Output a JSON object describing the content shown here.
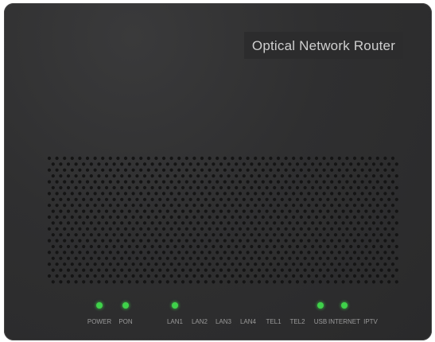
{
  "device": {
    "title": "Optical Network Router"
  },
  "indicators": [
    {
      "label": "POWER",
      "lit": true
    },
    {
      "label": "PON",
      "lit": true
    },
    {
      "label": "LAN1",
      "lit": true
    },
    {
      "label": "LAN2",
      "lit": false
    },
    {
      "label": "LAN3",
      "lit": false
    },
    {
      "label": "LAN4",
      "lit": false
    },
    {
      "label": "TEL1",
      "lit": false
    },
    {
      "label": "TEL2",
      "lit": false
    },
    {
      "label": "USB",
      "lit": true
    },
    {
      "label": "INTERNET",
      "lit": true
    },
    {
      "label": "IPTV",
      "lit": false
    }
  ],
  "colors": {
    "body": "#2f2f30",
    "led_on": "#3fd24a",
    "label_text": "#9a9a9a",
    "title_text": "#cfcfcf",
    "vent_hole": "#141414"
  }
}
